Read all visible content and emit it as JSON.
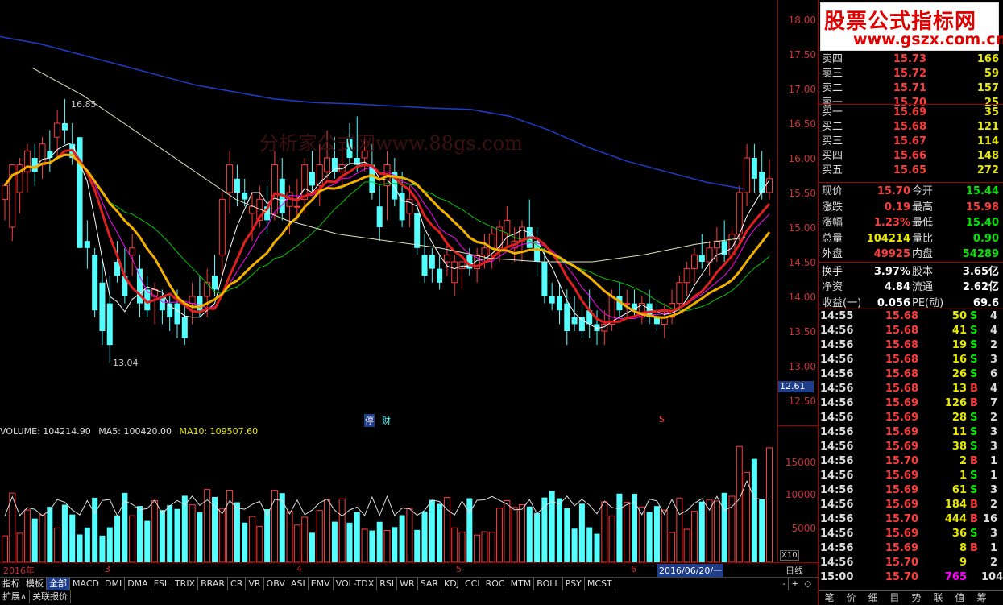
{
  "watermark": "分析家公式网www.88gs.com",
  "logo": {
    "line1": "股票公式指标网",
    "line2": "www.gszx.com.cn"
  },
  "chart_annotations": {
    "high": "16.85",
    "low": "13.04"
  },
  "price_axis": [
    "18.00",
    "17.50",
    "17.00",
    "16.50",
    "16.00",
    "15.50",
    "15.00",
    "14.50",
    "14.00",
    "13.50",
    "13.00",
    "12.50"
  ],
  "current_price_tag": "12.61",
  "markers": {
    "ting": "停",
    "cai": "财",
    "s": "S"
  },
  "volume": {
    "label": "VOLUME: 104214.90",
    "ma5": "MA5: 100420.00",
    "ma10": "MA10: 109507.60",
    "axis": [
      "15000",
      "10000",
      "5000"
    ],
    "unit": "X10"
  },
  "x_axis": {
    "labels": [
      "2016年",
      "3",
      "4",
      "5",
      "6"
    ],
    "selected_date": "2016/06/20/一",
    "period": "日线"
  },
  "toolbar1": [
    "指标",
    "模板",
    "全部",
    "MACD",
    "DMI",
    "DMA",
    "FSL",
    "TRIX",
    "BRAR",
    "CR",
    "VR",
    "OBV",
    "ASI",
    "EMV",
    "VOL-TDX",
    "RSI",
    "WR",
    "SAR",
    "KDJ",
    "CCI",
    "ROC",
    "MTM",
    "BOLL",
    "PSY",
    "MCST"
  ],
  "toolbar1_right": [
    "日线",
    "-",
    "+",
    "◇"
  ],
  "toolbar2": [
    "扩展∧",
    "关联报价"
  ],
  "quotes": {
    "sell": [
      {
        "label": "卖四",
        "price": "15.73",
        "vol": "166"
      },
      {
        "label": "卖三",
        "price": "15.72",
        "vol": "59"
      },
      {
        "label": "卖二",
        "price": "15.71",
        "vol": "157"
      },
      {
        "label": "卖一",
        "price": "15.70",
        "vol": "25"
      }
    ],
    "buy": [
      {
        "label": "买一",
        "price": "15.69",
        "vol": "35"
      },
      {
        "label": "买二",
        "price": "15.68",
        "vol": "121"
      },
      {
        "label": "买三",
        "price": "15.67",
        "vol": "114"
      },
      {
        "label": "买四",
        "price": "15.66",
        "vol": "148"
      },
      {
        "label": "买五",
        "price": "15.65",
        "vol": "272"
      }
    ]
  },
  "stats": [
    {
      "l1": "现价",
      "v1": "15.70",
      "c1": "red",
      "l2": "今开",
      "v2": "15.44",
      "c2": "green"
    },
    {
      "l1": "涨跌",
      "v1": "0.19",
      "c1": "red",
      "l2": "最高",
      "v2": "15.98",
      "c2": "red"
    },
    {
      "l1": "涨幅",
      "v1": "1.23%",
      "c1": "red",
      "l2": "最低",
      "v2": "15.40",
      "c2": "green"
    },
    {
      "l1": "总量",
      "v1": "104214",
      "c1": "yellow",
      "l2": "量比",
      "v2": "0.90",
      "c2": "green"
    },
    {
      "l1": "外盘",
      "v1": "49925",
      "c1": "red",
      "l2": "内盘",
      "v2": "54289",
      "c2": "green"
    },
    {
      "l1": "换手",
      "v1": "3.97%",
      "c1": "white",
      "l2": "股本",
      "v2": "3.65亿",
      "c2": "white"
    },
    {
      "l1": "净资",
      "v1": "4.84",
      "c1": "white",
      "l2": "流通",
      "v2": "2.62亿",
      "c2": "white"
    },
    {
      "l1": "收益(一)",
      "v1": "0.056",
      "c1": "white",
      "l2": "PE(动)",
      "v2": "69.6",
      "c2": "white"
    }
  ],
  "trades": [
    {
      "t": "14:55",
      "p": "15.68",
      "v": "50",
      "bs": "S",
      "n": "4"
    },
    {
      "t": "14:56",
      "p": "15.68",
      "v": "41",
      "bs": "S",
      "n": "4"
    },
    {
      "t": "14:56",
      "p": "15.68",
      "v": "19",
      "bs": "S",
      "n": "2"
    },
    {
      "t": "14:56",
      "p": "15.68",
      "v": "16",
      "bs": "S",
      "n": "3"
    },
    {
      "t": "14:56",
      "p": "15.68",
      "v": "26",
      "bs": "S",
      "n": "6"
    },
    {
      "t": "14:56",
      "p": "15.68",
      "v": "13",
      "bs": "B",
      "n": "4"
    },
    {
      "t": "14:56",
      "p": "15.69",
      "v": "126",
      "bs": "B",
      "n": "7"
    },
    {
      "t": "14:56",
      "p": "15.69",
      "v": "28",
      "bs": "S",
      "n": "2"
    },
    {
      "t": "14:56",
      "p": "15.69",
      "v": "11",
      "bs": "S",
      "n": "3"
    },
    {
      "t": "14:56",
      "p": "15.69",
      "v": "38",
      "bs": "S",
      "n": "3"
    },
    {
      "t": "14:56",
      "p": "15.70",
      "v": "2",
      "bs": "B",
      "n": "1"
    },
    {
      "t": "14:56",
      "p": "15.69",
      "v": "1",
      "bs": "S",
      "n": "1"
    },
    {
      "t": "14:56",
      "p": "15.69",
      "v": "61",
      "bs": "S",
      "n": "3"
    },
    {
      "t": "14:56",
      "p": "15.69",
      "v": "184",
      "bs": "B",
      "n": "2"
    },
    {
      "t": "14:56",
      "p": "15.70",
      "v": "444",
      "bs": "B",
      "n": "16"
    },
    {
      "t": "14:56",
      "p": "15.69",
      "v": "36",
      "bs": "S",
      "n": "3"
    },
    {
      "t": "14:56",
      "p": "15.69",
      "v": "8",
      "bs": "B",
      "n": "1"
    },
    {
      "t": "14:56",
      "p": "15.70",
      "v": "9",
      "bs": "",
      "n": "2"
    },
    {
      "t": "15:00",
      "p": "15.70",
      "v": "765",
      "bs": "",
      "n": "104"
    }
  ],
  "bottom_tabs": [
    "笔",
    "价",
    "细",
    "目",
    "势",
    "联",
    "值",
    "筹"
  ],
  "colors": {
    "up": "#ff3c3c",
    "down": "#54ffff",
    "ma_white": "#ffffff",
    "ma_yellow": "#e8e800",
    "ma_magenta": "#ff00ff",
    "ma_green": "#00c800",
    "ma_blue": "#1e3cc8",
    "ma_cream": "#e0e0c0"
  }
}
